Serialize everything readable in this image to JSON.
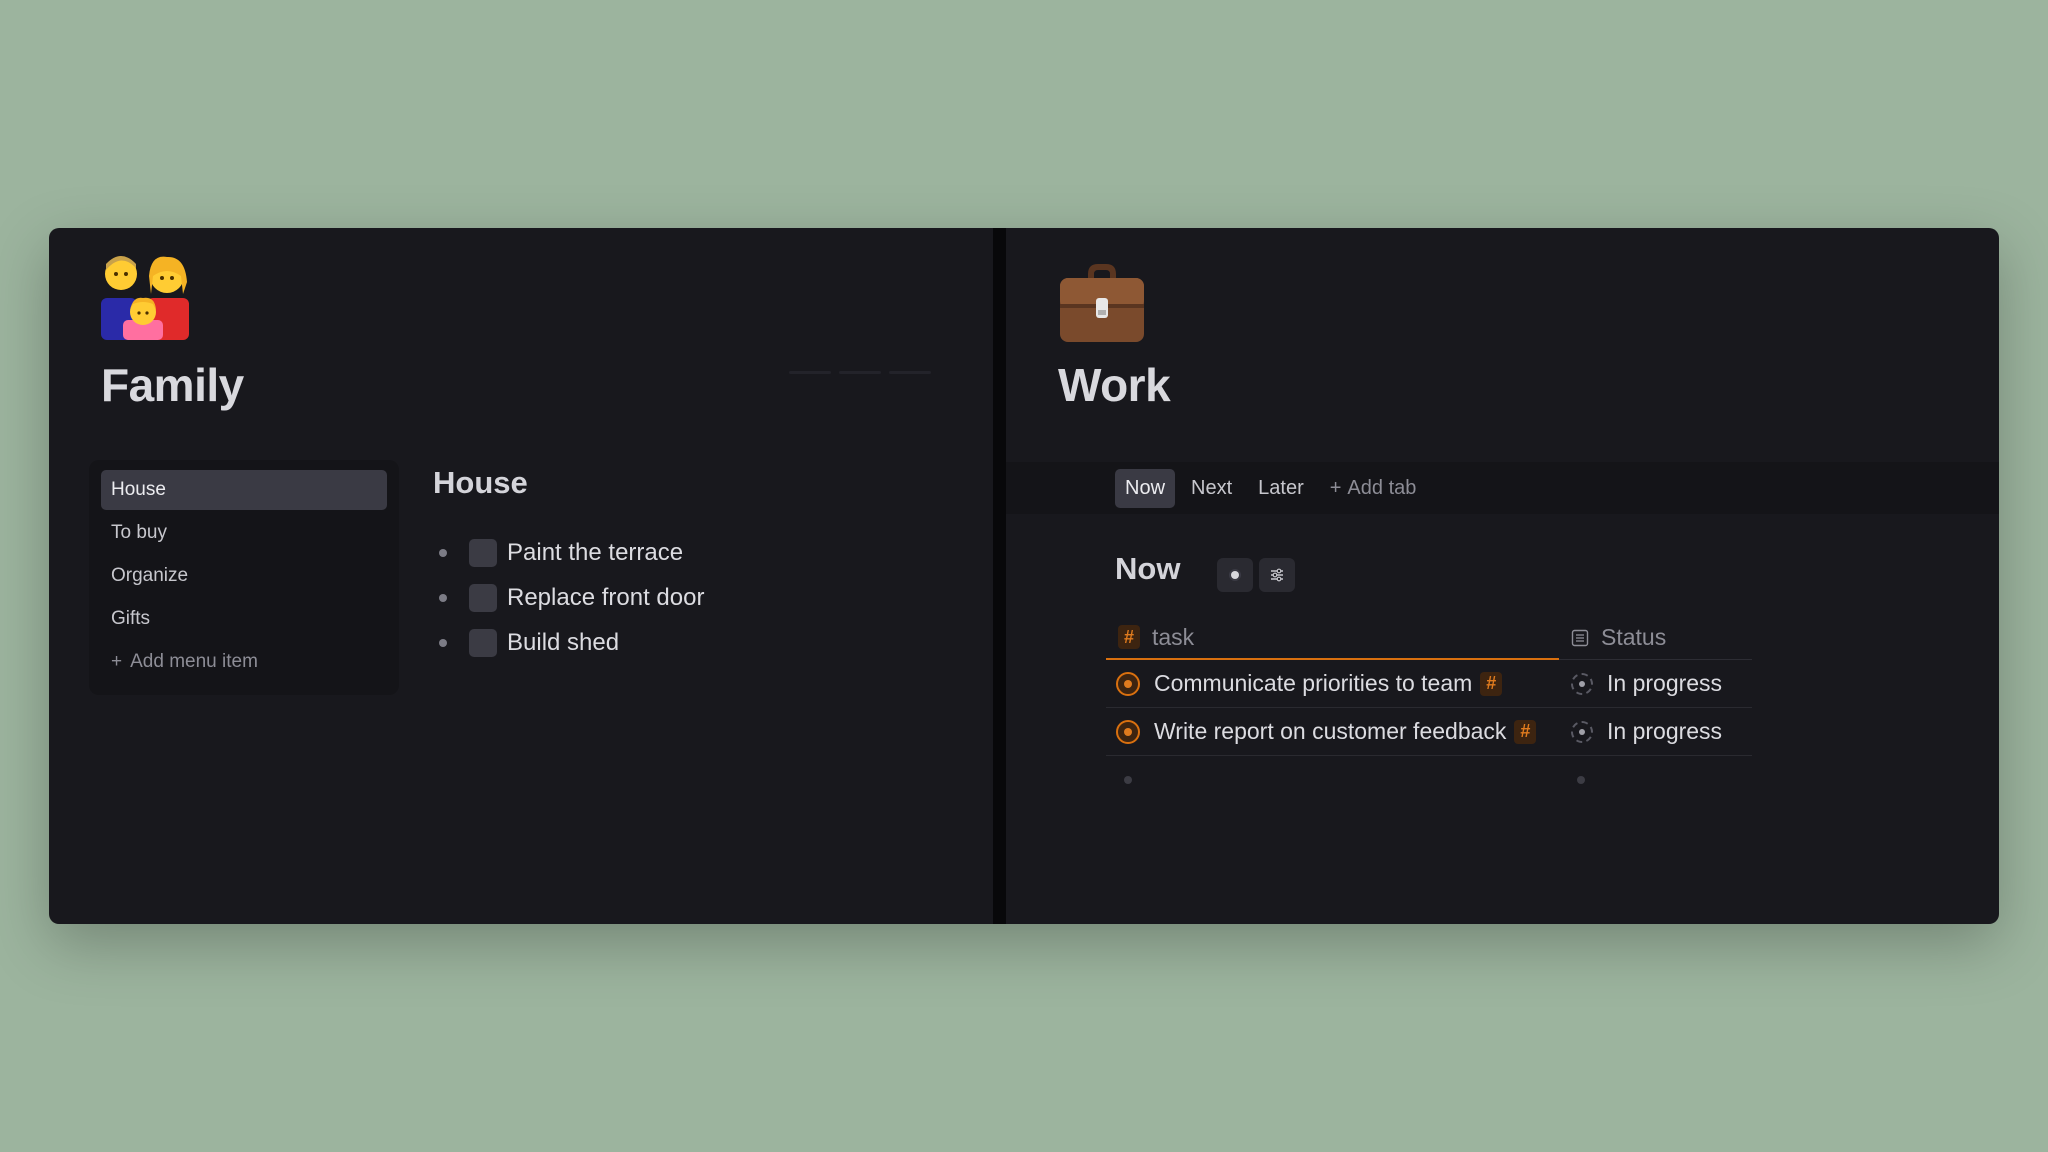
{
  "family": {
    "title": "Family",
    "emoji": "family-emoji",
    "menu": {
      "items": [
        {
          "label": "House",
          "active": true
        },
        {
          "label": "To buy",
          "active": false
        },
        {
          "label": "Organize",
          "active": false
        },
        {
          "label": "Gifts",
          "active": false
        }
      ],
      "add_label": "Add menu item"
    },
    "section_title": "House",
    "todos": [
      {
        "label": "Paint the terrace",
        "checked": false
      },
      {
        "label": "Replace front door",
        "checked": false
      },
      {
        "label": "Build shed",
        "checked": false
      }
    ]
  },
  "work": {
    "title": "Work",
    "emoji": "briefcase-emoji",
    "tabs": [
      {
        "label": "Now",
        "active": true
      },
      {
        "label": "Next",
        "active": false
      },
      {
        "label": "Later",
        "active": false
      }
    ],
    "add_tab_label": "Add tab",
    "section_title": "Now",
    "table": {
      "headers": {
        "task": "task",
        "status": "Status"
      },
      "rows": [
        {
          "task": "Communicate priorities to team",
          "status": "In progress"
        },
        {
          "task": "Write report on customer feedback",
          "status": "In progress"
        }
      ]
    }
  },
  "colors": {
    "background": "#9cb49e",
    "window": "#18181d",
    "accent_orange": "#d9700f",
    "active_item": "#3a3a44"
  }
}
